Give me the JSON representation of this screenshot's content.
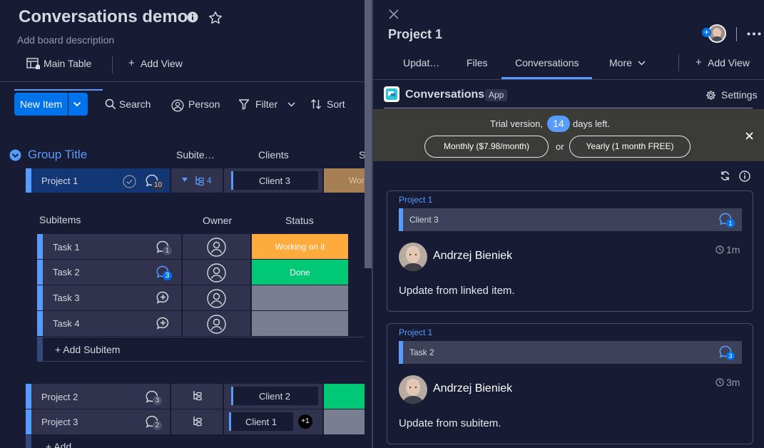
{
  "board": {
    "title": "Conversations demo",
    "description": "Add board description",
    "views": {
      "main": "Main Table",
      "add": "Add View"
    },
    "toolbar": {
      "new_item": "New Item",
      "search": "Search",
      "person": "Person",
      "filter": "Filter",
      "sort": "Sort"
    },
    "group": {
      "title": "Group Title",
      "columns": [
        "Subite…",
        "Clients",
        "S"
      ]
    },
    "items": [
      {
        "name": "Project 1",
        "updates": "10",
        "subitems": "4",
        "client": "Client 3",
        "status": "Wor"
      },
      {
        "name": "Project 2",
        "updates": "3",
        "client": "Client 2"
      },
      {
        "name": "Project 3",
        "updates": "2",
        "client": "Client 1",
        "client_extra": "+1"
      }
    ],
    "subitems": {
      "columns": [
        "Subitems",
        "Owner",
        "Status"
      ],
      "rows": [
        {
          "name": "Task 1",
          "updates": "1",
          "status": "Working on it",
          "status_color": "#fdab3d"
        },
        {
          "name": "Task 2",
          "updates": "3",
          "status": "Done",
          "status_color": "#00c875"
        },
        {
          "name": "Task 3",
          "updates": "",
          "status": "",
          "status_color": "#797e93"
        },
        {
          "name": "Task 4",
          "updates": "",
          "status": "",
          "status_color": "#797e93"
        }
      ],
      "add": "+ Add Subitem"
    },
    "add_item": "+ Add"
  },
  "panel": {
    "title": "Project 1",
    "tabs": [
      "Updat…",
      "Files",
      "Conversations",
      "More"
    ],
    "add_view": "Add View",
    "app": {
      "name": "Conversations",
      "badge": "App",
      "settings": "Settings"
    },
    "trial": {
      "prefix": "Trial version,",
      "days": "14",
      "suffix": "days left.",
      "monthly": "Monthly ($7.98/month)",
      "or": "or",
      "yearly": "Yearly (1 month FREE)"
    },
    "cards": [
      {
        "item": "Project 1",
        "context": "Client 3",
        "count": "1",
        "author": "Andrzej Bieniek",
        "time": "1m",
        "body": "Update from linked item."
      },
      {
        "item": "Project 1",
        "context": "Task 2",
        "count": "3",
        "author": "Andrzej Bieniek",
        "time": "3m",
        "body": "Update from subitem."
      }
    ]
  },
  "colors": {
    "accent": "#0073ea",
    "link": "#579bfc",
    "done": "#00c875",
    "working": "#fdab3d",
    "group": "#579bfc"
  }
}
